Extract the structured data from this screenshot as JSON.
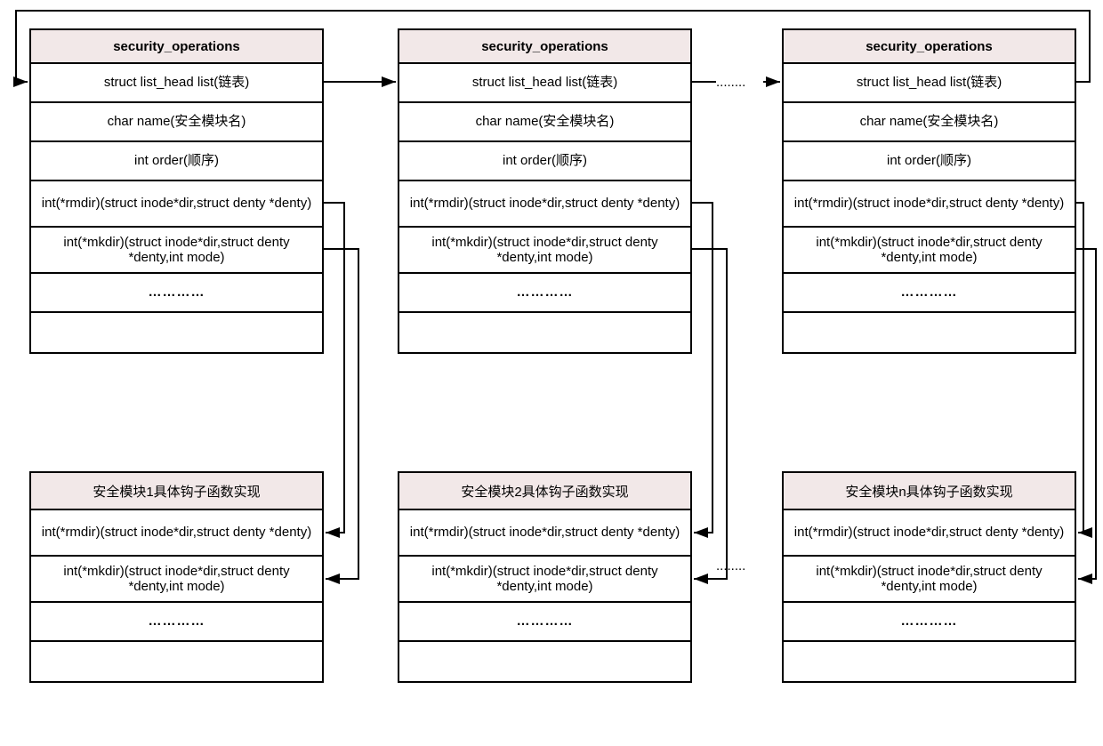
{
  "top_header": "security_operations",
  "top_rows": {
    "list": "struct list_head list(链表)",
    "name": "char name(安全模块名)",
    "order": "int order(顺序)",
    "rmdir": "int(*rmdir)(struct inode*dir,struct denty *denty)",
    "mkdir": "int(*mkdir)(struct inode*dir,struct denty *denty,int mode)",
    "dots": "…………"
  },
  "bottom_headers": {
    "b1": "安全模块1具体钩子函数实现",
    "b2": "安全模块2具体钩子函数实现",
    "bn": "安全模块n具体钩子函数实现"
  },
  "bottom_rows": {
    "rmdir": "int(*rmdir)(struct inode*dir,struct denty *denty)",
    "mkdir": "int(*mkdir)(struct inode*dir,struct denty *denty,int mode)",
    "dots": "…………"
  },
  "ellipsis1": "........",
  "ellipsis2": "........"
}
